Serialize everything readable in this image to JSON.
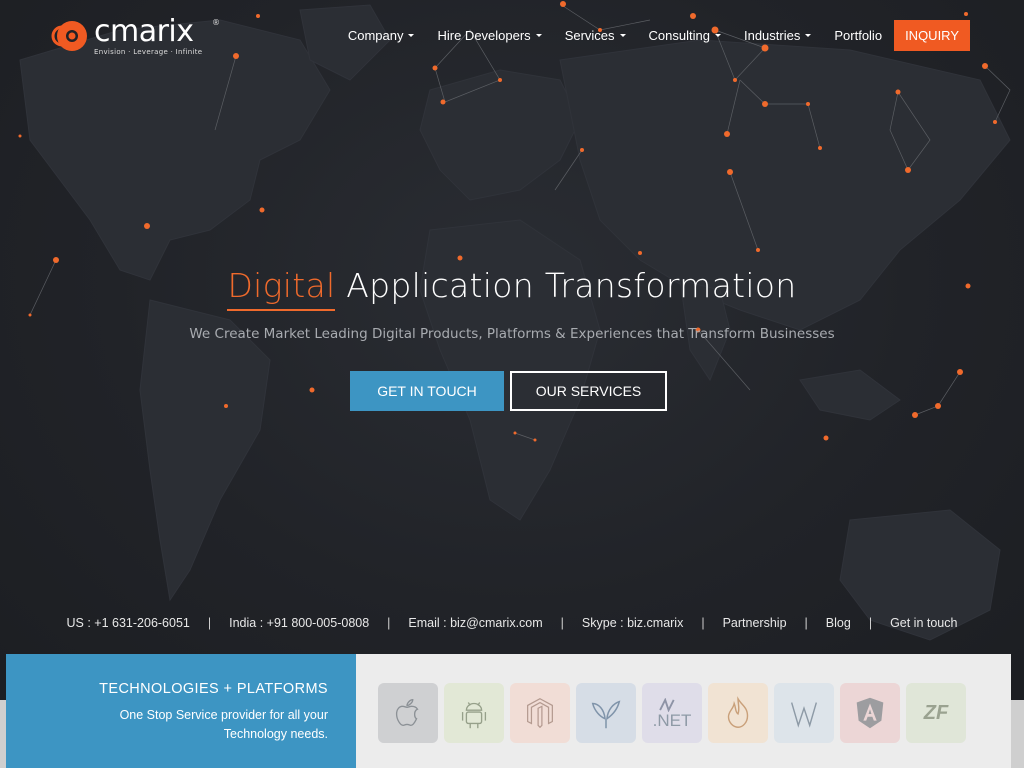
{
  "brand": {
    "name": "cmarix",
    "tagline": "Envision · Leverage · Infinite",
    "registered": "®",
    "accent": "#f05a22"
  },
  "nav": {
    "items": [
      {
        "label": "Company",
        "dropdown": true
      },
      {
        "label": "Hire Developers",
        "dropdown": true
      },
      {
        "label": "Services",
        "dropdown": true
      },
      {
        "label": "Consulting",
        "dropdown": true
      },
      {
        "label": "Industries",
        "dropdown": true
      },
      {
        "label": "Portfolio",
        "dropdown": false
      }
    ],
    "cta": "INQUIRY"
  },
  "hero": {
    "headline_accent": "Digital",
    "headline_rest": "Application Transformation",
    "subheadline": "We Create Market Leading Digital Products, Platforms & Experiences that Transform Businesses",
    "primary_button": "GET IN TOUCH",
    "secondary_button": "OUR SERVICES"
  },
  "contact": {
    "us_phone": "US : +1 631-206-6051",
    "india_phone": "India : +91 800-005-0808",
    "email": "Email : biz@cmarix.com",
    "skype": "Skype : biz.cmarix",
    "partnership": "Partnership",
    "blog": "Blog",
    "get_in_touch": "Get in touch",
    "separator": "|"
  },
  "technologies": {
    "title": "TECHNOLOGIES + PLATFORMS",
    "description_line1": "One Stop Service provider for all your",
    "description_line2": "Technology needs.",
    "tiles": [
      {
        "icon": "apple-icon",
        "bg": "#cfd0d2"
      },
      {
        "icon": "android-icon",
        "bg": "#e2e8d6"
      },
      {
        "icon": "magento-icon",
        "bg": "#f1ddd6"
      },
      {
        "icon": "yii-icon",
        "bg": "#d6dde6"
      },
      {
        "icon": "dotnet-icon",
        "bg": "#dfdde9",
        "label": ".NET"
      },
      {
        "icon": "codeigniter-icon",
        "bg": "#f1e3d3"
      },
      {
        "icon": "wordpress-icon",
        "bg": "#dde4ea"
      },
      {
        "icon": "angular-icon",
        "bg": "#ecd6d6"
      },
      {
        "icon": "zend-icon",
        "bg": "#e0e6d8",
        "label": "ZF"
      }
    ]
  },
  "colors": {
    "accent": "#f05a22",
    "blue": "#3d95c3",
    "background": "#202226"
  }
}
